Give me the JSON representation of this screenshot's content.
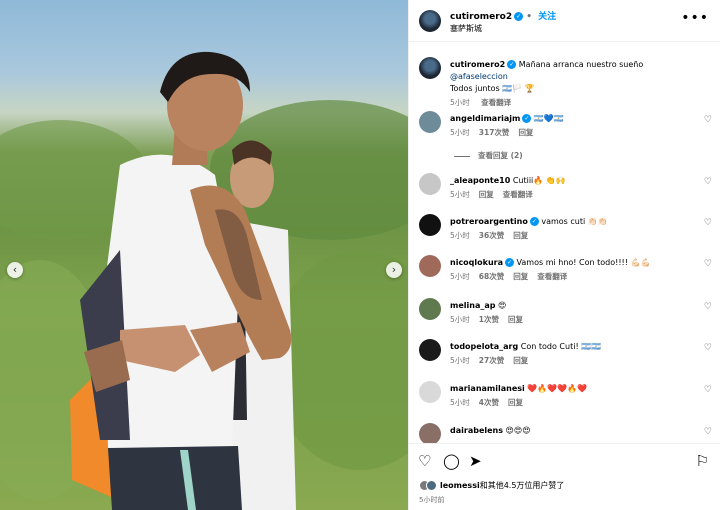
{
  "post": {
    "nav_prev": "‹",
    "nav_next": "›"
  },
  "header": {
    "username": "cutiromero2",
    "follow_label": "关注",
    "location": "塞萨斯城",
    "more_label": "•••"
  },
  "caption": {
    "username": "cutiromero2",
    "text": "Mañana arranca nuestro sueño ",
    "mention": "@afaseleccion",
    "text2": "Todos juntos 🇦🇷🏳️ 🏆",
    "time": "5小时",
    "translate": "查看翻译"
  },
  "comments": [
    {
      "username": "angeldimariajm",
      "verified": true,
      "text": "🇦🇷💙🇦🇷",
      "time": "5小时",
      "likes": "317次赞",
      "reply": "回复",
      "translate": "",
      "avatar_color": "#6d8b99"
    },
    {
      "username": "_aleaponte10",
      "verified": false,
      "text": "Cutiii🔥 👏🙌",
      "time": "5小时",
      "likes": "",
      "reply": "回复",
      "translate": "查看翻译",
      "avatar_color": "#c7c7c7"
    },
    {
      "username": "potreroargentino",
      "verified": true,
      "text": "vamos cuti 👏🏻👏🏻",
      "time": "5小时",
      "likes": "36次赞",
      "reply": "回复",
      "translate": "",
      "avatar_color": "#111111"
    },
    {
      "username": "nicoqlokura",
      "verified": true,
      "text": "Vamos mi hno! Con todo!!!! 💪🏻💪🏻",
      "time": "5小时",
      "likes": "68次赞",
      "reply": "回复",
      "translate": "查看翻译",
      "avatar_color": "#a06a5a"
    },
    {
      "username": "melina_ap",
      "verified": false,
      "text": "😍",
      "time": "5小时",
      "likes": "1次赞",
      "reply": "回复",
      "translate": "",
      "avatar_color": "#5f7a4f"
    },
    {
      "username": "todopelota_arg",
      "verified": false,
      "text": "Con todo Cuti! 🇦🇷🇦🇷",
      "time": "5小时",
      "likes": "27次赞",
      "reply": "回复",
      "translate": "",
      "avatar_color": "#1a1a1a"
    },
    {
      "username": "marianamilanesi",
      "verified": false,
      "text": "❤️🔥❤️❤️🔥❤️",
      "time": "5小时",
      "likes": "4次赞",
      "reply": "回复",
      "translate": "",
      "avatar_color": "#d9d9d9"
    },
    {
      "username": "dairabelens",
      "verified": false,
      "text": "😍😍😍",
      "time": "5小时",
      "likes": "",
      "reply": "",
      "translate": "",
      "avatar_color": "#8a6f66"
    }
  ],
  "view_replies": "查看回复 (2)",
  "footer": {
    "liker": "leomessi",
    "likes_text": "和其他4.5万位用户赞了",
    "time": "5小时前"
  },
  "colors": {
    "accent": "#0095f6",
    "muted": "#737373"
  }
}
